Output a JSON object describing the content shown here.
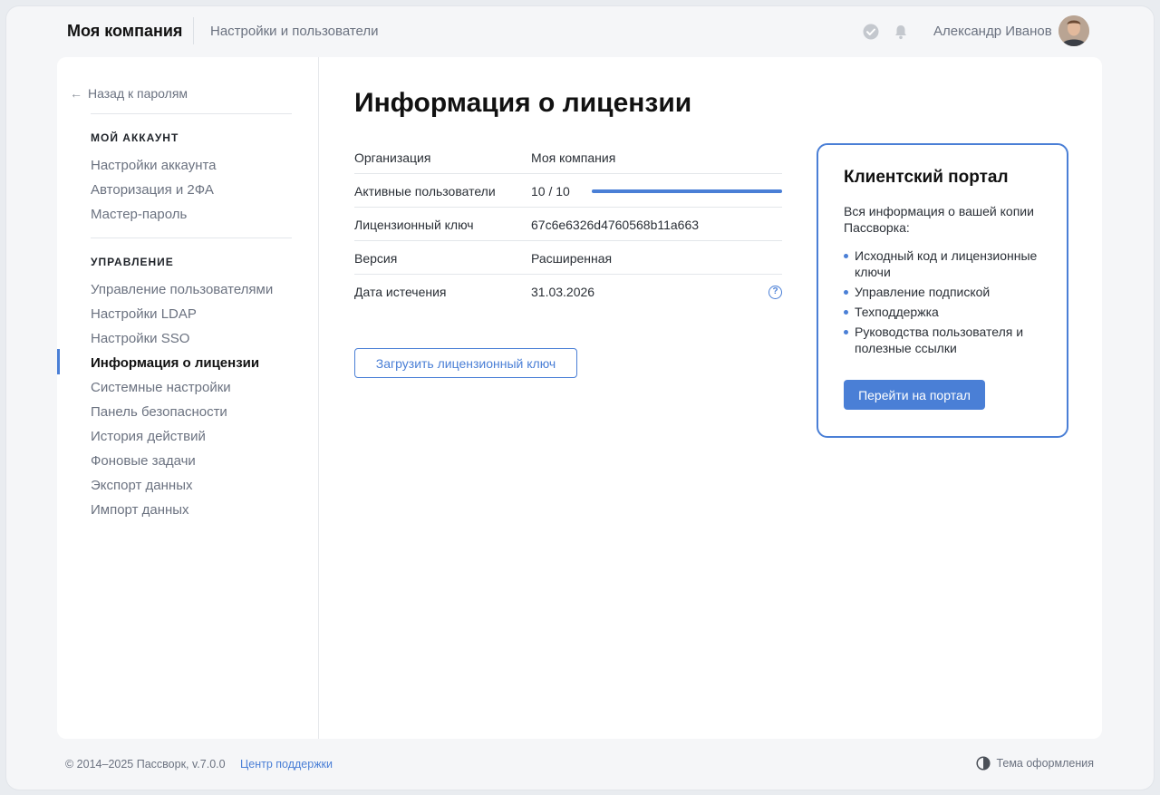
{
  "header": {
    "brand": "Моя компания",
    "breadcrumb": "Настройки и пользователи",
    "user_name": "Александр Иванов"
  },
  "sidebar": {
    "back_label": "Назад к паролям",
    "sections": [
      {
        "title": "МОЙ АККАУНТ",
        "items": [
          "Настройки аккаунта",
          "Авторизация и 2ФА",
          "Мастер-пароль"
        ]
      },
      {
        "title": "УПРАВЛЕНИЕ",
        "items": [
          "Управление пользователями",
          "Настройки LDAP",
          "Настройки SSO",
          "Информация о лицензии",
          "Системные настройки",
          "Панель безопасности",
          "История действий",
          "Фоновые задачи",
          "Экспорт данных",
          "Импорт данных"
        ]
      }
    ],
    "active_item": "Информация о лицензии"
  },
  "main": {
    "title": "Информация о лицензии",
    "rows": [
      {
        "label": "Организация",
        "value": "Моя компания"
      },
      {
        "label": "Активные пользователи",
        "value": "10 / 10",
        "progress": 1.0
      },
      {
        "label": "Лицензионный ключ",
        "value": "67c6e6326d4760568b11a663"
      },
      {
        "label": "Версия",
        "value": "Расширенная"
      },
      {
        "label": "Дата истечения",
        "value": "31.03.2026"
      }
    ],
    "help_glyph": "?",
    "upload_button": "Загрузить лицензионный ключ"
  },
  "portal": {
    "title": "Клиентский портал",
    "description": "Вся информация о вашей копии Пассворка:",
    "items": [
      "Исходный код и лицензионные ключи",
      "Управление подпиской",
      "Техподдержка",
      "Руководства пользователя и полезные ссылки"
    ],
    "button": "Перейти на портал"
  },
  "footer": {
    "copyright": "© 2014–2025 Пассворк, v.7.0.0",
    "support_link": "Центр поддержки",
    "theme_label": "Тема оформления"
  },
  "colors": {
    "accent": "#4a7fd6",
    "background": "#f5f6f8",
    "card": "#ffffff"
  },
  "icons": [
    "check-circle-icon",
    "bell-icon",
    "arrow-left-icon",
    "help-icon",
    "half-circle-icon"
  ]
}
